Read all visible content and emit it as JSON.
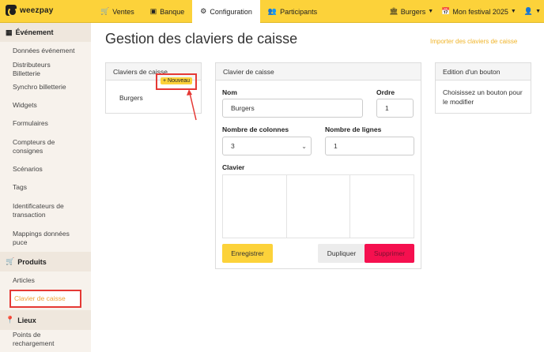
{
  "app": {
    "logo_text": "weezpay"
  },
  "topnav": {
    "items": [
      {
        "label": "Ventes",
        "icon": "cart-icon"
      },
      {
        "label": "Banque",
        "icon": "money-icon"
      },
      {
        "label": "Configuration",
        "icon": "gear-icon",
        "active": true
      },
      {
        "label": "Participants",
        "icon": "users-icon"
      }
    ],
    "shop": {
      "label": "Burgers",
      "icon": "shop-icon"
    },
    "event": {
      "label": "Mon festival 2025",
      "icon": "calendar-icon"
    },
    "user_icon": "user-icon"
  },
  "sidebar": {
    "sections": [
      {
        "title": "Événement",
        "icon": "calendar-icon",
        "items": [
          "Données événement",
          "Distributeurs Billetterie",
          "Synchro billetterie",
          "Widgets",
          "Formulaires",
          "Compteurs de consignes",
          "Scénarios",
          "Tags",
          "Identificateurs de transaction",
          "Mappings données puce"
        ]
      },
      {
        "title": "Produits",
        "icon": "cart-icon",
        "items": [
          "Articles",
          "Clavier de caisse"
        ]
      },
      {
        "title": "Lieux",
        "icon": "map-pin-icon",
        "items": [
          "Points de rechargement"
        ]
      }
    ]
  },
  "main": {
    "title": "Gestion des claviers de caisse",
    "import_link": "Importer des claviers de caisse",
    "list_panel": {
      "header": "Claviers de caisse",
      "new_button": "+ Nouveau",
      "items": [
        "Burgers"
      ]
    },
    "editor": {
      "header": "Clavier de caisse",
      "name_label": "Nom",
      "name_value": "Burgers",
      "order_label": "Ordre",
      "order_value": "1",
      "columns_label": "Nombre de colonnes",
      "columns_value": "3",
      "rows_label": "Nombre de lignes",
      "rows_value": "1",
      "keyboard_label": "Clavier",
      "save_button": "Enregistrer",
      "duplicate_button": "Dupliquer",
      "delete_button": "Supprimer"
    },
    "button_panel": {
      "header": "Edition d'un bouton",
      "help": "Choisissez un bouton pour le modifier"
    }
  },
  "colors": {
    "accent": "#fcd23a",
    "danger": "#f5104f",
    "highlight_box": "#e53935",
    "link": "#f0b429"
  }
}
